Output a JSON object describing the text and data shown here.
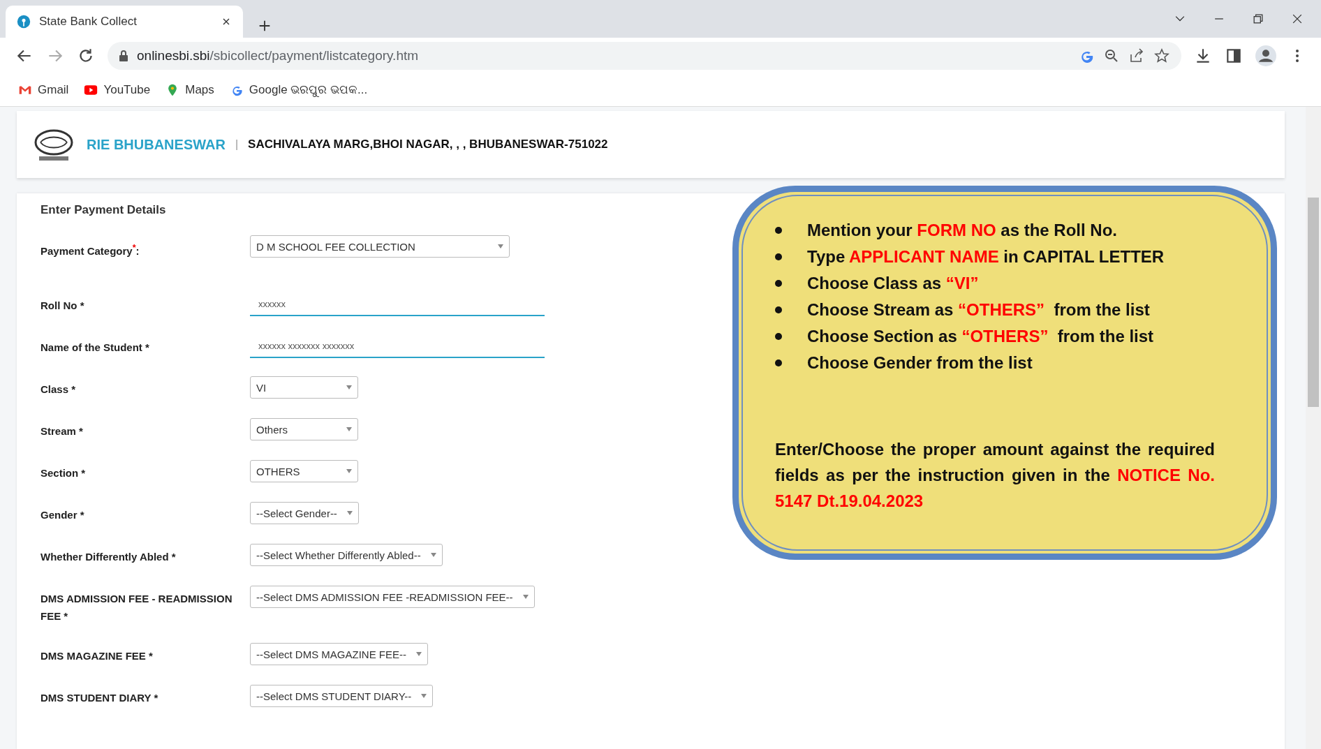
{
  "browser": {
    "tab": {
      "title": "State Bank Collect",
      "selected": true
    },
    "url": {
      "host": "onlinesbi.sbi",
      "path": "/sbicollect/payment/listcategory.htm"
    },
    "bookmarks": [
      {
        "label": "Gmail",
        "kind": "gmail"
      },
      {
        "label": "YouTube",
        "kind": "youtube"
      },
      {
        "label": "Maps",
        "kind": "maps"
      },
      {
        "label": "Google ଭରପୁର ଭପକ...",
        "kind": "google"
      }
    ]
  },
  "header": {
    "institute": "RIE BHUBANESWAR",
    "separator": "|",
    "address": "SACHIVALAYA MARG,BHOI NAGAR, , , BHUBANESWAR-751022"
  },
  "form": {
    "title": "Enter Payment Details",
    "fields": [
      {
        "label": "Payment Category$^{*}$:",
        "kind": "select",
        "value": "D M SCHOOL FEE COLLECTION"
      },
      {
        "label": "Roll No *",
        "kind": "text",
        "value": "xxxxxx"
      },
      {
        "label": "Name of the Student *",
        "kind": "text",
        "value": "xxxxxx xxxxxxx xxxxxxx"
      },
      {
        "label": "Class *",
        "kind": "select",
        "value": "VI"
      },
      {
        "label": "Stream *",
        "kind": "select",
        "value": "Others"
      },
      {
        "label": "Section *",
        "kind": "select",
        "value": "OTHERS"
      },
      {
        "label": "Gender *",
        "kind": "select",
        "value": "--Select Gender--"
      },
      {
        "label": "Whether Differently Abled *",
        "kind": "select",
        "value": "--Select Whether Differently Abled--"
      },
      {
        "label": "DMS ADMISSION FEE - READMISSION FEE *",
        "kind": "select",
        "value": "--Select DMS ADMISSION FEE -READMISSION FEE--"
      },
      {
        "label": "DMS MAGAZINE FEE *",
        "kind": "select",
        "value": "--Select DMS MAGAZINE FEE--"
      },
      {
        "label": "DMS STUDENT DIARY *",
        "kind": "select",
        "value": "--Select DMS STUDENT DIARY--"
      }
    ]
  },
  "notice": {
    "bullets": [
      [
        {
          "text": "Mention your ",
          "highlight": false
        },
        {
          "text": "FORM NO",
          "highlight": true
        },
        {
          "text": " as the Roll No.",
          "highlight": false
        }
      ],
      [
        {
          "text": "Type ",
          "highlight": false
        },
        {
          "text": "APPLICANT NAME",
          "highlight": true
        },
        {
          "text": " in CAPITAL LETTER",
          "highlight": false
        }
      ],
      [
        {
          "text": "Choose Class as ",
          "highlight": false
        },
        {
          "text": "“VI”",
          "highlight": true
        }
      ],
      [
        {
          "text": "Choose Stream as ",
          "highlight": false
        },
        {
          "text": "“OTHERS”",
          "highlight": true
        },
        {
          "text": "  from the list",
          "highlight": false
        }
      ],
      [
        {
          "text": "Choose Section as ",
          "highlight": false
        },
        {
          "text": "“OTHERS”",
          "highlight": true
        },
        {
          "text": "  from the list",
          "highlight": false
        }
      ],
      [
        {
          "text": "Choose Gender from the list",
          "highlight": false
        }
      ]
    ],
    "paragraph": [
      {
        "text": "Enter/Choose the proper amount against the required fields as per the instruction given in the ",
        "highlight": false
      },
      {
        "text": "NOTICE No. 5147 Dt.19.04.2023",
        "highlight": true
      }
    ]
  }
}
